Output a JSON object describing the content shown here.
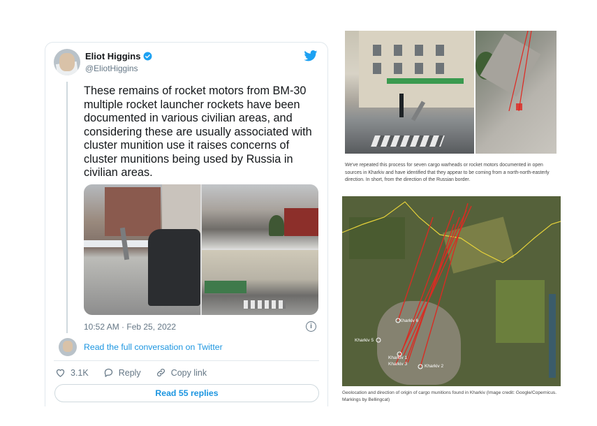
{
  "tweet": {
    "author_name": "Eliot Higgins",
    "handle": "@EliotHiggins",
    "text": "These remains of rocket motors from BM-30 multiple rocket launcher rockets have been documented in various civilian areas, and considering these are usually associated with cluster munition use it raises concerns of cluster munitions being used by Russia in civilian areas.",
    "timestamp": "10:52 AM · Feb 25, 2022",
    "conversation_link": "Read the full conversation on Twitter",
    "likes_count": "3.1K",
    "reply_label": "Reply",
    "copy_link_label": "Copy link",
    "read_replies_label": "Read 55 replies",
    "accent_color": "#1b95e0",
    "icons": [
      "verified-badge-icon",
      "twitter-bird-icon",
      "info-icon",
      "heart-icon",
      "reply-icon",
      "link-icon"
    ]
  },
  "article": {
    "caption_top": "We've repeated this process for seven cargo warheads or rocket motors documented in open sources in Kharkiv and have identified that they appear to be coming from a north-north-easterly direction. In short, from the direction of the Russian border.",
    "map_labels": {
      "kharkiv_6": "Kharkiv 6",
      "kharkiv_5": "Kharkiv 5",
      "kharkiv_1": "Kharkiv 1",
      "kharkiv_2": "Kharkiv 2",
      "kharkiv_3": "Kharkiv 3"
    },
    "caption_bottom": "Geolocation and direction of origin of cargo munitions found in Kharkiv (Image credit: Google/Copernicus. Markings by Bellingcat)"
  }
}
